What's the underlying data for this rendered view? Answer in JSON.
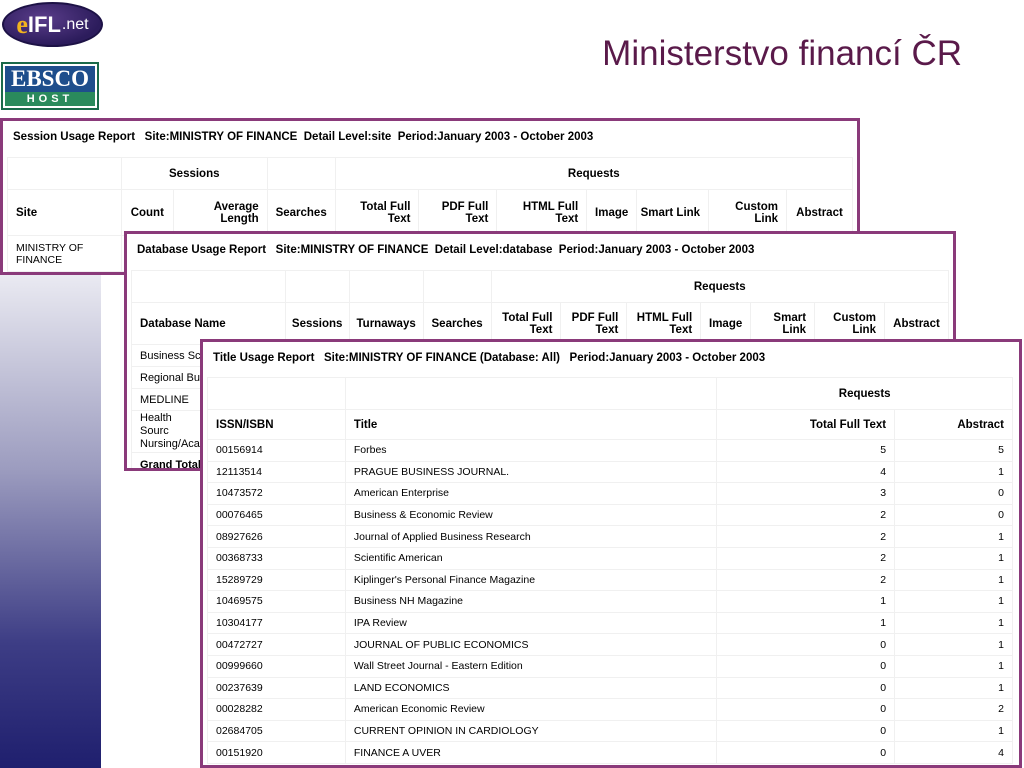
{
  "slide": {
    "title": "Ministerstvo financí ČR",
    "logo_eifl": {
      "e": "e",
      "ifl": "IFL",
      "net": ".net"
    },
    "logo_ebsco": {
      "top": "EBSCO",
      "bottom": "HOST"
    }
  },
  "session_report": {
    "title": "Session Usage Report   Site:MINISTRY OF FINANCE  Detail Level:site  Period:January 2003 - October 2003",
    "group_sessions": "Sessions",
    "group_requests": "Requests",
    "columns": [
      "Site",
      "Count",
      "Average Length",
      "Searches",
      "Total Full Text",
      "PDF Full Text",
      "HTML Full Text",
      "Image",
      "Smart Link",
      "Custom Link",
      "Abstract"
    ],
    "rows": [
      [
        "MINISTRY OF FINANCE",
        "",
        "",
        "",
        "",
        "",
        "",
        "",
        "",
        "",
        ""
      ]
    ]
  },
  "database_report": {
    "title": "Database Usage Report   Site:MINISTRY OF FINANCE  Detail Level:database  Period:January 2003 - October 2003",
    "group_requests": "Requests",
    "columns": [
      "Database Name",
      "Sessions",
      "Turnaways",
      "Searches",
      "Total Full Text",
      "PDF Full Text",
      "HTML Full Text",
      "Image",
      "Smart Link",
      "Custom Link",
      "Abstract"
    ],
    "rows": [
      "Business Sc",
      "Regional Bu",
      "MEDLINE",
      "Health Sourc Nursing/Acac"
    ],
    "grand_total": "Grand Total"
  },
  "title_report": {
    "title": "Title Usage Report   Site:MINISTRY OF FINANCE (Database: All)   Period:January 2003 - October 2003",
    "group_requests": "Requests",
    "columns": [
      "ISSN/ISBN",
      "Title",
      "Total Full Text",
      "Abstract"
    ],
    "rows": [
      {
        "issn": "00156914",
        "title": "Forbes",
        "total": "5",
        "abstract": "5"
      },
      {
        "issn": "12113514",
        "title": "PRAGUE BUSINESS JOURNAL.",
        "total": "4",
        "abstract": "1"
      },
      {
        "issn": "10473572",
        "title": "American Enterprise",
        "total": "3",
        "abstract": "0"
      },
      {
        "issn": "00076465",
        "title": "Business & Economic Review",
        "total": "2",
        "abstract": "0"
      },
      {
        "issn": "08927626",
        "title": "Journal of Applied Business Research",
        "total": "2",
        "abstract": "1"
      },
      {
        "issn": "00368733",
        "title": "Scientific American",
        "total": "2",
        "abstract": "1"
      },
      {
        "issn": "15289729",
        "title": "Kiplinger's Personal Finance Magazine",
        "total": "2",
        "abstract": "1"
      },
      {
        "issn": "10469575",
        "title": "Business NH Magazine",
        "total": "1",
        "abstract": "1"
      },
      {
        "issn": "10304177",
        "title": "IPA Review",
        "total": "1",
        "abstract": "1"
      },
      {
        "issn": "00472727",
        "title": "JOURNAL OF PUBLIC ECONOMICS",
        "total": "0",
        "abstract": "1"
      },
      {
        "issn": "00999660",
        "title": "Wall Street Journal - Eastern Edition",
        "total": "0",
        "abstract": "1"
      },
      {
        "issn": "00237639",
        "title": "LAND ECONOMICS",
        "total": "0",
        "abstract": "1"
      },
      {
        "issn": "00028282",
        "title": "American Economic Review",
        "total": "0",
        "abstract": "2"
      },
      {
        "issn": "02684705",
        "title": "CURRENT OPINION IN CARDIOLOGY",
        "total": "0",
        "abstract": "1"
      },
      {
        "issn": "00151920",
        "title": "FINANCE A UVER",
        "total": "0",
        "abstract": "4"
      }
    ]
  }
}
